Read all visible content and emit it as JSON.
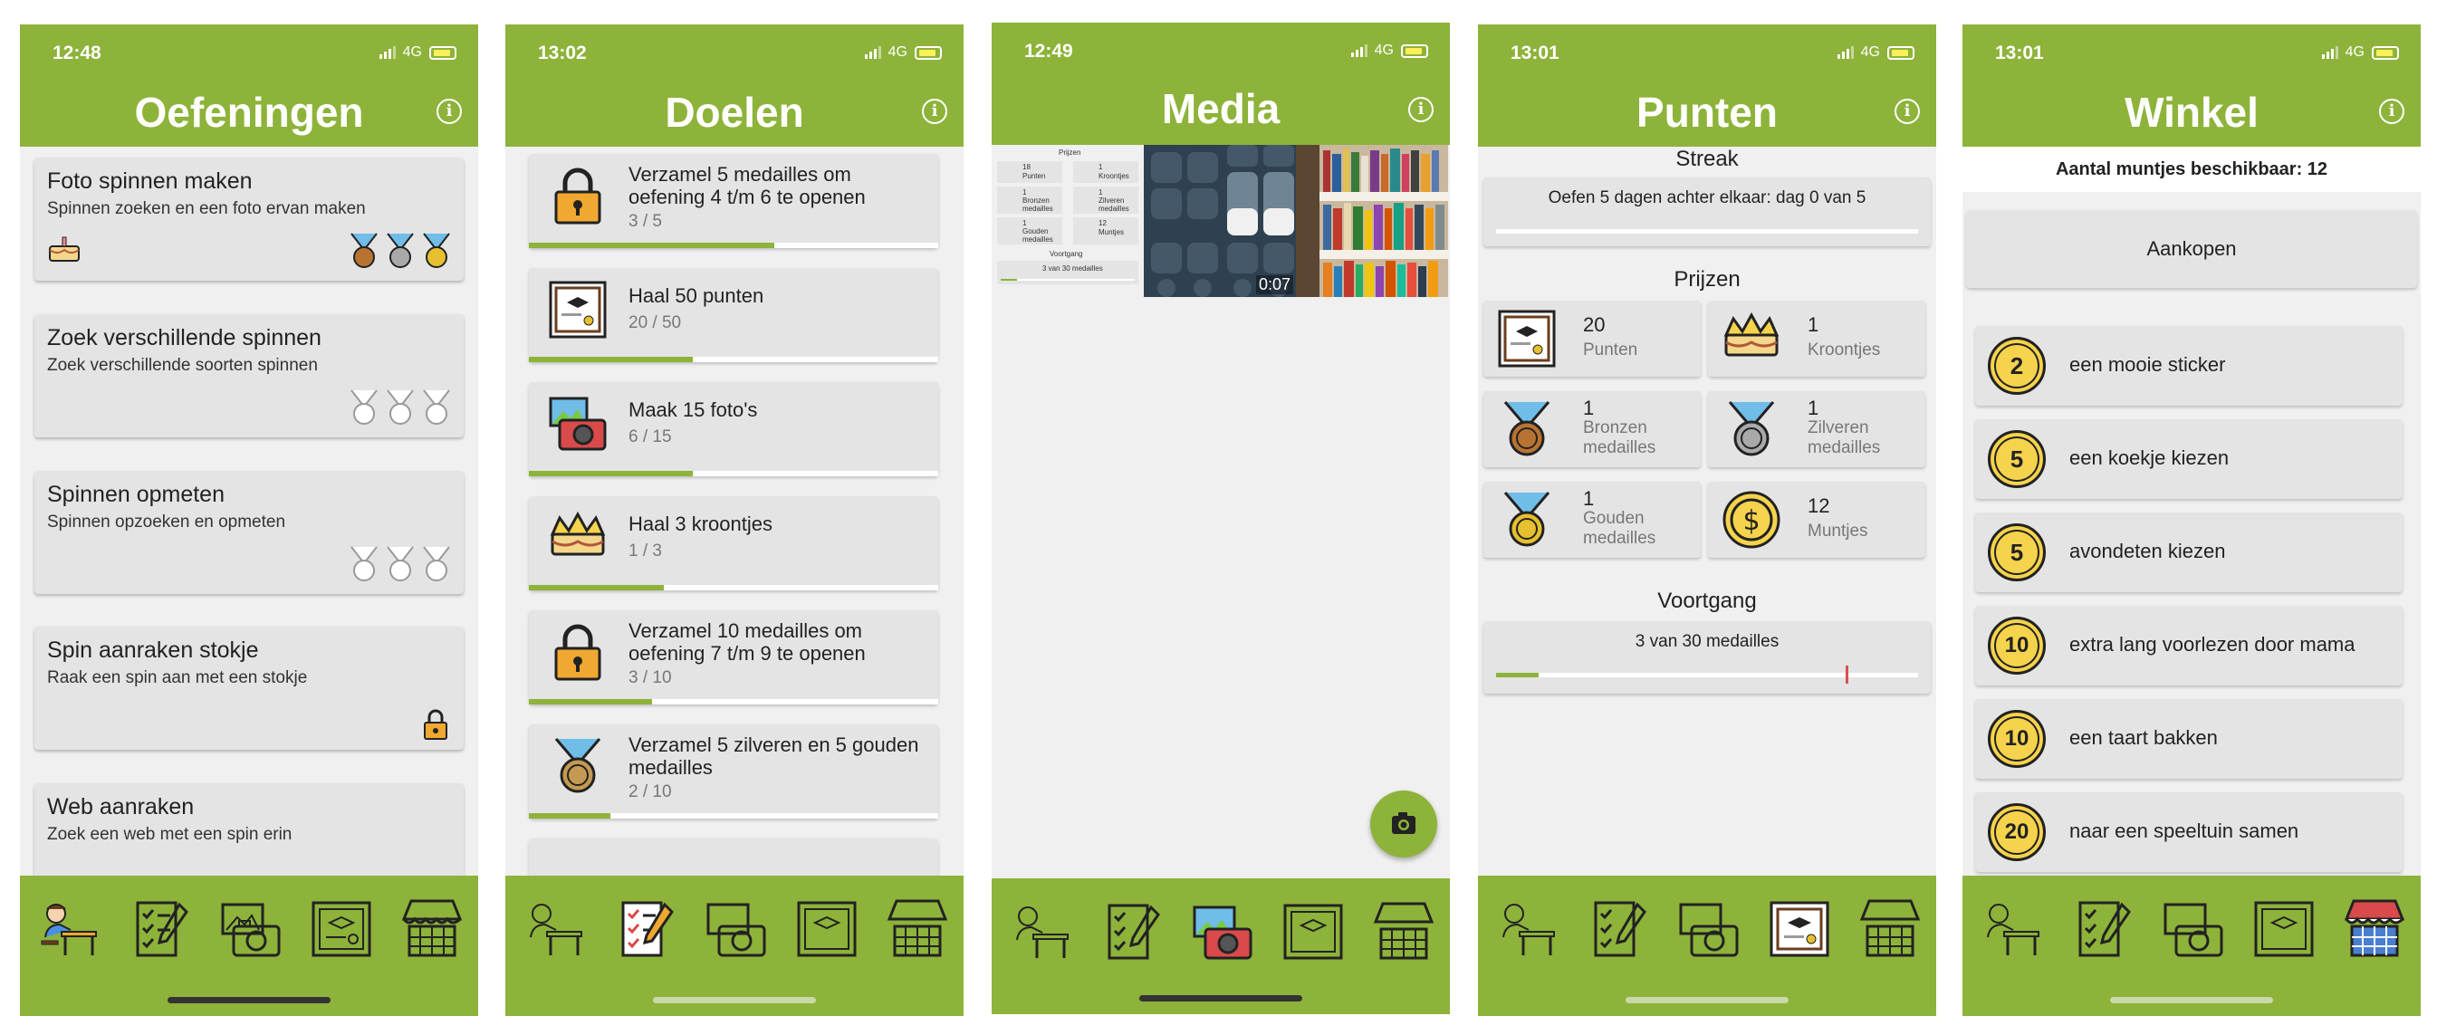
{
  "screens": {
    "oefeningen": {
      "time": "12:48",
      "network": "4G",
      "title": "Oefeningen",
      "info": "i",
      "exercises": [
        {
          "title": "Foto spinnen maken",
          "subtitle": "Spinnen zoeken en een foto ervan maken"
        },
        {
          "title": "Zoek verschillende spinnen",
          "subtitle": "Zoek verschillende soorten spinnen"
        },
        {
          "title": "Spinnen opmeten",
          "subtitle": "Spinnen opzoeken en opmeten"
        },
        {
          "title": "Spin aanraken stokje",
          "subtitle": "Raak een spin aan met een stokje"
        },
        {
          "title": "Web aanraken",
          "subtitle": "Zoek een web met een spin erin"
        }
      ]
    },
    "doelen": {
      "time": "13:02",
      "network": "4G",
      "title": "Doelen",
      "info": "i",
      "goals": [
        {
          "title": "Verzamel 5 medailles om oefening 4 t/m 6 te openen",
          "progress": "3 / 5",
          "fraction": 0.6
        },
        {
          "title": "Haal 50 punten",
          "progress": "20 / 50",
          "fraction": 0.4
        },
        {
          "title": "Maak 15 foto's",
          "progress": "6 / 15",
          "fraction": 0.4
        },
        {
          "title": "Haal 3 kroontjes",
          "progress": "1 / 3",
          "fraction": 0.33
        },
        {
          "title": "Verzamel 10 medailles om oefening 7 t/m 9 te openen",
          "progress": "3 / 10",
          "fraction": 0.3
        },
        {
          "title": "Verzamel 5 zilveren en 5 gouden medailles",
          "progress": "2 / 10",
          "fraction": 0.2
        }
      ]
    },
    "media": {
      "time": "12:49",
      "network": "4G",
      "title": "Media",
      "info": "i",
      "video_duration": "0:07",
      "mini": {
        "points": "18",
        "points_lbl": "Punten",
        "crowns": "1",
        "crowns_lbl": "Kroontjes",
        "bronze": "1",
        "bronze_lbl": "Bronzen medailles",
        "silver": "1",
        "silver_lbl": "Zilveren medailles",
        "gold": "1",
        "gold_lbl": "Gouden medailles",
        "coins": "12",
        "coins_lbl": "Muntjes",
        "progress_title": "Voortgang",
        "progress_text": "3 van 30 medailles",
        "top": "Prijzen"
      }
    },
    "punten": {
      "time": "13:01",
      "network": "4G",
      "title": "Punten",
      "info": "i",
      "streak_title": "Streak",
      "streak_text": "Oefen 5 dagen achter elkaar: dag 0 van 5",
      "prizes_title": "Prijzen",
      "prizes": [
        {
          "num": "20",
          "label": "Punten"
        },
        {
          "num": "1",
          "label": "Kroontjes"
        },
        {
          "num": "1",
          "label": "Bronzen medailles"
        },
        {
          "num": "1",
          "label": "Zilveren medailles"
        },
        {
          "num": "1",
          "label": "Gouden medailles"
        },
        {
          "num": "12",
          "label": "Muntjes"
        }
      ],
      "progress_title": "Voortgang",
      "progress_text": "3 van 30 medailles",
      "progress_fraction": 0.1
    },
    "winkel": {
      "time": "13:01",
      "network": "4G",
      "title": "Winkel",
      "info": "i",
      "coins_available": "Aantal muntjes beschikbaar: 12",
      "purchases_button": "Aankopen",
      "items": [
        {
          "cost": "2",
          "label": "een mooie sticker"
        },
        {
          "cost": "5",
          "label": "een koekje kiezen"
        },
        {
          "cost": "5",
          "label": "avondeten kiezen"
        },
        {
          "cost": "10",
          "label": "extra lang voorlezen door mama"
        },
        {
          "cost": "10",
          "label": "een taart bakken"
        },
        {
          "cost": "20",
          "label": "naar een speeltuin samen"
        }
      ]
    }
  },
  "colors": {
    "brand_green": "#8db33a",
    "card_bg": "#e4e4e4",
    "coin_gold": "#f6d34c",
    "progress_red": "#d65050"
  },
  "icons": {
    "tabs": [
      "student-desk-icon",
      "checklist-icon",
      "camera-photo-icon",
      "certificate-icon",
      "shop-stall-icon"
    ]
  }
}
